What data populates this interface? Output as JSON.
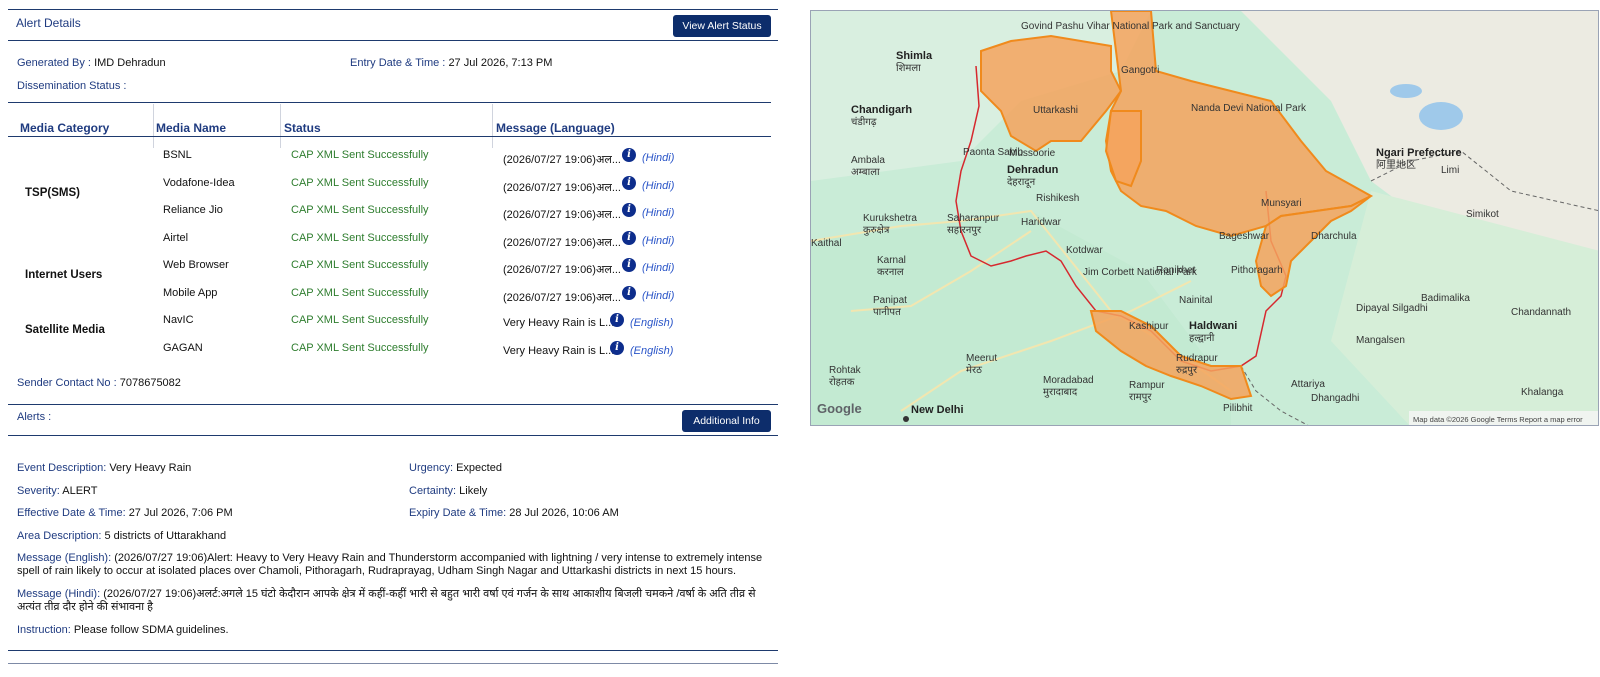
{
  "alert_details": {
    "title": "Alert Details",
    "view_status_button": "View Alert Status",
    "generated_by_label": "Generated By :",
    "generated_by_value": "IMD Dehradun",
    "entry_label": "Entry Date & Time :",
    "entry_value": "27 Jul 2026, 7:13 PM",
    "dissemination_label": "Dissemination Status :"
  },
  "table": {
    "headers": [
      "Media Category",
      "Media Name",
      "Status",
      "Message (Language)"
    ],
    "categories": [
      "TSP(SMS)",
      "Internet Users",
      "Satellite Media"
    ],
    "rows": [
      {
        "name": "BSNL",
        "status": "CAP XML Sent Successfully",
        "message": "(2026/07/27 19:06)अल...",
        "lang": "(Hindi)"
      },
      {
        "name": "Vodafone-Idea",
        "status": "CAP XML Sent Successfully",
        "message": "(2026/07/27 19:06)अल...",
        "lang": "(Hindi)"
      },
      {
        "name": "Reliance Jio",
        "status": "CAP XML Sent Successfully",
        "message": "(2026/07/27 19:06)अल...",
        "lang": "(Hindi)"
      },
      {
        "name": "Airtel",
        "status": "CAP XML Sent Successfully",
        "message": "(2026/07/27 19:06)अल...",
        "lang": "(Hindi)"
      },
      {
        "name": "Web Browser",
        "status": "CAP XML Sent Successfully",
        "message": "(2026/07/27 19:06)अल...",
        "lang": "(Hindi)"
      },
      {
        "name": "Mobile App",
        "status": "CAP XML Sent Successfully",
        "message": "(2026/07/27 19:06)अल...",
        "lang": "(Hindi)"
      },
      {
        "name": "NavIC",
        "status": "CAP XML Sent Successfully",
        "message": "Very Heavy Rain is L...",
        "lang": "(English)"
      },
      {
        "name": "GAGAN",
        "status": "CAP XML Sent Successfully",
        "message": "Very Heavy Rain is L...",
        "lang": "(English)"
      }
    ],
    "info_icon": "info-icon"
  },
  "sender": {
    "label": "Sender Contact No :",
    "value": "7078675082"
  },
  "alerts": {
    "title": "Alerts :",
    "additional_button": "Additional Info",
    "event_label": "Event Description:",
    "event_value": "Very Heavy Rain",
    "urgency_label": "Urgency:",
    "urgency_value": "Expected",
    "severity_label": "Severity:",
    "severity_value": "ALERT",
    "certainty_label": "Certainty:",
    "certainty_value": "Likely",
    "effective_label": "Effective Date & Time:",
    "effective_value": "27 Jul 2026, 7:06 PM",
    "expiry_label": "Expiry Date & Time:",
    "expiry_value": "28 Jul 2026, 10:06 AM",
    "area_label": "Area Description:",
    "area_value": "5 districts of Uttarakhand",
    "msg_en_label": "Message (English):",
    "msg_en_value": "(2026/07/27 19:06)Alert: Heavy to Very Heavy Rain and Thunderstorm accompanied with lightning / very intense to extremely intense spell of rain likely to occur at isolated places over Chamoli, Pithoragarh, Rudraprayag, Udham Singh Nagar and Uttarkashi districts in next 15 hours.",
    "msg_hi_label": "Message (Hindi):",
    "msg_hi_value": "(2026/07/27 19:06)अलर्ट:अगले 15 घंटो केदौरान आपके क्षेत्र में कहीं-कहीं भारी से बहुत भारी वर्षा एवं गर्जन के साथ आकाशीय बिजली चमकने /वर्षा के अति तीव्र से अत्यंत तीव्र दौर होने की संभावना है",
    "instruction_label": "Instruction:",
    "instruction_value": "Please follow SDMA guidelines."
  },
  "map": {
    "labels": {
      "shimla": "Shimla",
      "shimla_hi": "शिमला",
      "chandigarh": "Chandigarh",
      "chandigarh_hi": "चंडीगढ़",
      "ambala": "Ambala",
      "ambala_hi": "अम्बाला",
      "kurukshetra": "Kurukshetra",
      "kurukshetra_hi": "कुरुक्षेत्र",
      "karnal": "Karnal",
      "karnal_hi": "करनाल",
      "panipat": "Panipat",
      "panipat_hi": "पानीपत",
      "rohtak": "Rohtak",
      "rohtak_hi": "रोहतक",
      "new_delhi": "New Delhi",
      "meerut": "Meerut",
      "meerut_hi": "मेरठ",
      "moradabad": "Moradabad",
      "moradabad_hi": "मुरादाबाद",
      "rampur": "Rampur",
      "rampur_hi": "रामपुर",
      "pilibhit": "Pilibhit",
      "saharanpur": "Saharanpur",
      "saharanpur_hi": "सहारनपुर",
      "dehradun": "Dehradun",
      "dehradun_hi": "देहरादून",
      "mussoorie": "Mussoorie",
      "rishikesh": "Rishikesh",
      "haridwar": "Haridwar",
      "kotdwar": "Kotdwar",
      "jim_corbett": "Jim Corbett National Park",
      "ramnagar": "Ramnagar",
      "ranikhet": "Ranikhet",
      "nainital": "Nainital",
      "haldwani": "Haldwani",
      "haldwani_hi": "हल्द्वानी",
      "rudrapur": "Rudrapur",
      "rudrapur_hi": "रुद्रपुर",
      "kashipur": "Kashipur",
      "gangotri": "Gangotri",
      "uttarkashi": "Uttarkashi",
      "govind": "Govind Pashu Vihar National Park and Sanctuary",
      "nanda_devi": "Nanda Devi National Park",
      "munsyari": "Munsyari",
      "pithoragarh": "Pithoragarh",
      "bageshwar": "Bageshwar",
      "dharchula": "Dharchula",
      "ngari": "Ngari Prefecture",
      "ngari_hi": "阿里地区",
      "limi": "Limi",
      "simikot": "Simikot",
      "dipayal": "Dipayal Silgadhi",
      "mangalsen": "Mangalsen",
      "attariya": "Attariya",
      "dhangadhi": "Dhangadhi",
      "khalanga": "Khalanga",
      "chandannath": "Chandannath",
      "badimalika": "Badimalika",
      "paonta": "Paonta Sahib",
      "kaithal": "Kaithal",
      "google": "Google",
      "attribution": "Map data ©2026 Google   Terms   Report a map error"
    }
  }
}
